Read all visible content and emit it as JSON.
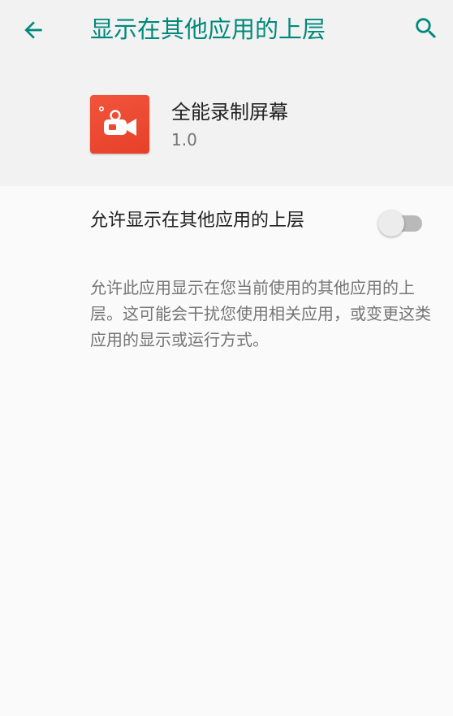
{
  "colors": {
    "accent": "#00897b",
    "header_bg": "#f2f2f2",
    "page_bg": "#fafafa",
    "app_icon_bg": "#ec4a33"
  },
  "toolbar": {
    "title": "显示在其他应用的上层",
    "back_icon": "arrow-back-icon",
    "search_icon": "search-icon"
  },
  "app": {
    "name": "全能录制屏幕",
    "version": "1.0",
    "icon": "video-camera-icon"
  },
  "setting": {
    "label": "允许显示在其他应用的上层",
    "enabled": false,
    "description": "允许此应用显示在您当前使用的其他应用的上层。这可能会干扰您使用相关应用，或变更这类应用的显示或运行方式。"
  }
}
